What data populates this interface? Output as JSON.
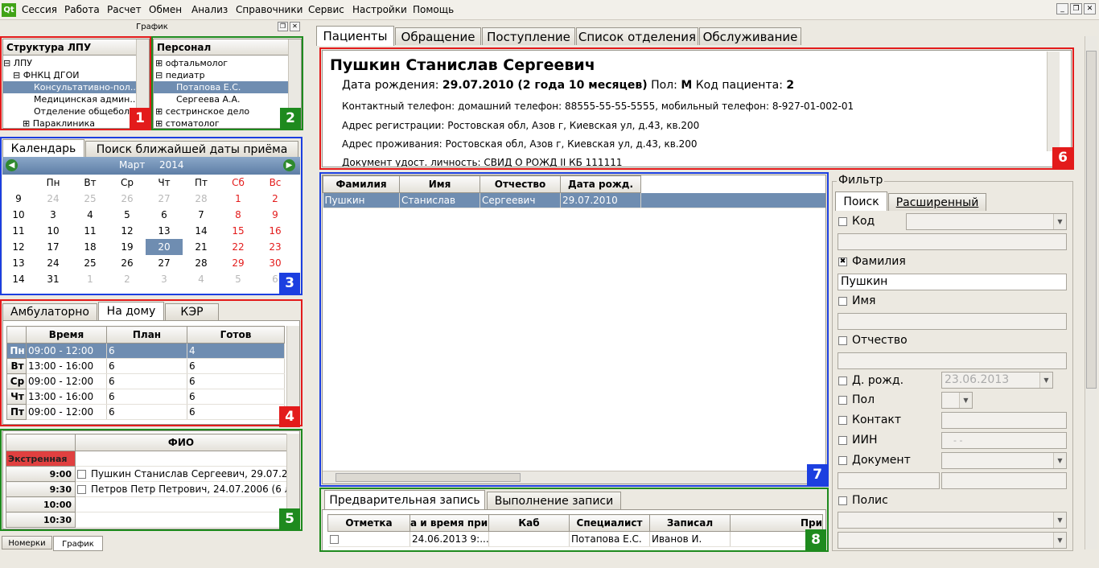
{
  "menu": {
    "items": [
      "Сессия",
      "Работа",
      "Расчет",
      "Обмен",
      "Анализ",
      "Справочники",
      "Сервис",
      "Настройки",
      "Помощь"
    ],
    "logo": "Qt"
  },
  "dock": {
    "title": "График"
  },
  "lpu": {
    "header": "Структура ЛПУ",
    "items": [
      "ЛПУ",
      "ФНКЦ ДГОИ",
      "Консультативно-пол...",
      "Медицинская админ...",
      "Отделение общебол",
      "Параклиника"
    ]
  },
  "staff": {
    "header": "Персонал",
    "items": [
      "офтальмолог",
      "педиатр",
      "Потапова Е.С.",
      "Сергеева А.А.",
      "сестринское дело",
      "стоматолог"
    ]
  },
  "calendar": {
    "tabs": [
      "Календарь",
      "Поиск ближайшей даты приёма"
    ],
    "month": "Март",
    "year": "2014",
    "weekdays": [
      "Пн",
      "Вт",
      "Ср",
      "Чт",
      "Пт",
      "Сб",
      "Вс"
    ],
    "weeks": [
      {
        "n": "9",
        "d": [
          "24",
          "25",
          "26",
          "27",
          "28",
          "1",
          "2"
        ]
      },
      {
        "n": "10",
        "d": [
          "3",
          "4",
          "5",
          "6",
          "7",
          "8",
          "9"
        ]
      },
      {
        "n": "11",
        "d": [
          "10",
          "11",
          "12",
          "13",
          "14",
          "15",
          "16"
        ]
      },
      {
        "n": "12",
        "d": [
          "17",
          "18",
          "19",
          "20",
          "21",
          "22",
          "23"
        ]
      },
      {
        "n": "13",
        "d": [
          "24",
          "25",
          "26",
          "27",
          "28",
          "29",
          "30"
        ]
      },
      {
        "n": "14",
        "d": [
          "31",
          "1",
          "2",
          "3",
          "4",
          "5",
          "6"
        ]
      }
    ]
  },
  "schedule": {
    "tabs": [
      "Амбулаторно",
      "На дому",
      "КЭР"
    ],
    "columns": [
      "Время",
      "План",
      "Готов"
    ],
    "rows": [
      {
        "day": "Пн",
        "time": "09:00 - 12:00",
        "plan": "6",
        "ready": "4"
      },
      {
        "day": "Вт",
        "time": "13:00 - 16:00",
        "plan": "6",
        "ready": "6"
      },
      {
        "day": "Ср",
        "time": "09:00 - 12:00",
        "plan": "6",
        "ready": "6"
      },
      {
        "day": "Чт",
        "time": "13:00 - 16:00",
        "plan": "6",
        "ready": "6"
      },
      {
        "day": "Пт",
        "time": "09:00 - 12:00",
        "plan": "6",
        "ready": "6"
      }
    ]
  },
  "appointments": {
    "column": "ФИО",
    "emergency": "Экстренная",
    "rows": [
      {
        "time": "9:00",
        "name": "Пушкин Станислав Сергеевич, 29.07.20"
      },
      {
        "time": "9:30",
        "name": "Петров Петр Петрович, 24.07.2006 (6 ле"
      },
      {
        "time": "10:00",
        "name": ""
      },
      {
        "time": "10:30",
        "name": ""
      }
    ]
  },
  "bottom_tabs": [
    "Номерки",
    "График"
  ],
  "main_tabs": [
    "Пациенты",
    "Обращение",
    "Поступление",
    "Список отделения",
    "Обслуживание"
  ],
  "patient": {
    "name": "Пушкин Станислав Сергеевич",
    "dob_label": "Дата рождения:",
    "dob": "29.07.2010 (2 года 10 месяцев)",
    "sex_label": "Пол:",
    "sex": "М",
    "code_label": "Код пациента:",
    "code": "2",
    "phone": "Контактный телефон: домашний телефон: 88555-55-55-5555, мобильный телефон: 8-927-01-002-01",
    "reg_addr": "Адрес регистрации: Ростовская обл, Азов г, Киевская ул, д.43, кв.200",
    "live_addr": "Адрес проживания: Ростовская обл, Азов г, Киевская ул, д.43, кв.200",
    "doc": "Документ удост. личность: СВИД О РОЖД II КБ 111111"
  },
  "patients_table": {
    "columns": [
      "Фамилия",
      "Имя",
      "Отчество",
      "Дата рожд."
    ],
    "rows": [
      [
        "Пушкин",
        "Станислав",
        "Сергеевич",
        "29.07.2010"
      ]
    ]
  },
  "filter": {
    "title": "Фильтр",
    "tabs": [
      "Поиск",
      "Расширенный"
    ],
    "code": "Код",
    "surname": "Фамилия",
    "surname_value": "Пушкин",
    "name": "Имя",
    "patronymic": "Отчество",
    "dob": "Д. рожд.",
    "dob_value": "23.06.2013",
    "sex": "Пол",
    "contact": "Контакт",
    "iin": "ИИН",
    "iin_mask": "- -",
    "document": "Документ",
    "policy": "Полис"
  },
  "records": {
    "tabs": [
      "Предварительная запись",
      "Выполнение записи"
    ],
    "columns": [
      "Отметка",
      "а и время при",
      "Каб",
      "Специалист",
      "Записал",
      "При"
    ],
    "rows": [
      [
        "",
        "24.06.2013 9:...",
        "",
        "Потапова Е.С.",
        "Иванов И.",
        ""
      ]
    ]
  },
  "badges": [
    "1",
    "2",
    "3",
    "4",
    "5",
    "6",
    "7",
    "8"
  ],
  "colors": {
    "red": "#e31b1b",
    "green": "#1e8a1e",
    "blue": "#1c3fe0",
    "selection": "#6f8db1"
  }
}
